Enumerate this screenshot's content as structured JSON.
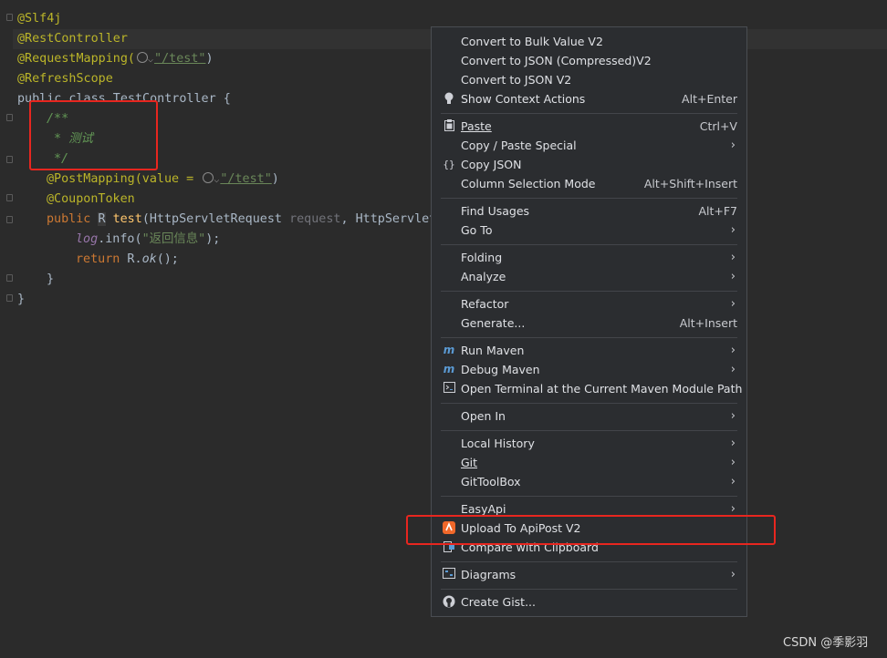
{
  "editor": {
    "lines": [
      "@Slf4j",
      "@RestController",
      "@RequestMapping(",
      "\"/test\"",
      ")",
      "@RefreshScope",
      "public class TestController {",
      "/**",
      "* 测试",
      "*/",
      "@PostMapping(value = ",
      "\"/test\"",
      ")",
      "@CouponToken",
      "public",
      "R",
      "test",
      "(HttpServletRequest ",
      "request",
      ", HttpServlet",
      "log",
      ".info(",
      "\"返回信息\"",
      ");",
      "return",
      " R.",
      "ok",
      "();",
      "}",
      "}"
    ]
  },
  "menu": {
    "items": [
      {
        "label": "Convert to Bulk Value V2",
        "shortcut": "",
        "submenu": false,
        "icon": ""
      },
      {
        "label": "Convert to JSON (Compressed)V2",
        "shortcut": "",
        "submenu": false,
        "icon": ""
      },
      {
        "label": "Convert to JSON V2",
        "shortcut": "",
        "submenu": false,
        "icon": ""
      },
      {
        "label": "Show Context Actions",
        "shortcut": "Alt+Enter",
        "submenu": false,
        "icon": "lightbulb-icon"
      },
      {
        "label": "Paste",
        "shortcut": "Ctrl+V",
        "submenu": false,
        "icon": "clipboard-icon"
      },
      {
        "label": "Copy / Paste Special",
        "shortcut": "",
        "submenu": true,
        "icon": ""
      },
      {
        "label": "Copy JSON",
        "shortcut": "",
        "submenu": false,
        "icon": "braces-icon"
      },
      {
        "label": "Column Selection Mode",
        "shortcut": "Alt+Shift+Insert",
        "submenu": false,
        "icon": ""
      },
      {
        "label": "Find Usages",
        "shortcut": "Alt+F7",
        "submenu": false,
        "icon": ""
      },
      {
        "label": "Go To",
        "shortcut": "",
        "submenu": true,
        "icon": ""
      },
      {
        "label": "Folding",
        "shortcut": "",
        "submenu": true,
        "icon": ""
      },
      {
        "label": "Analyze",
        "shortcut": "",
        "submenu": true,
        "icon": ""
      },
      {
        "label": "Refactor",
        "shortcut": "",
        "submenu": true,
        "icon": ""
      },
      {
        "label": "Generate...",
        "shortcut": "Alt+Insert",
        "submenu": false,
        "icon": ""
      },
      {
        "label": "Run Maven",
        "shortcut": "",
        "submenu": true,
        "icon": "maven-run-icon"
      },
      {
        "label": "Debug Maven",
        "shortcut": "",
        "submenu": true,
        "icon": "maven-debug-icon"
      },
      {
        "label": "Open Terminal at the Current Maven Module Path",
        "shortcut": "",
        "submenu": false,
        "icon": "terminal-icon"
      },
      {
        "label": "Open In",
        "shortcut": "",
        "submenu": true,
        "icon": ""
      },
      {
        "label": "Local History",
        "shortcut": "",
        "submenu": true,
        "icon": ""
      },
      {
        "label": "Git",
        "shortcut": "",
        "submenu": true,
        "icon": ""
      },
      {
        "label": "GitToolBox",
        "shortcut": "",
        "submenu": true,
        "icon": ""
      },
      {
        "label": "EasyApi",
        "shortcut": "",
        "submenu": true,
        "icon": ""
      },
      {
        "label": "Upload To ApiPost V2",
        "shortcut": "",
        "submenu": false,
        "icon": "apipost-icon"
      },
      {
        "label": "Compare with Clipboard",
        "shortcut": "",
        "submenu": false,
        "icon": "compare-icon"
      },
      {
        "label": "Diagrams",
        "shortcut": "",
        "submenu": true,
        "icon": "diagram-icon"
      },
      {
        "label": "Create Gist...",
        "shortcut": "",
        "submenu": false,
        "icon": "github-icon"
      }
    ]
  },
  "watermark": "CSDN @季影羽",
  "colors": {
    "highlight_box": "#e8261f",
    "menu_bg": "#2b2d30",
    "editor_bg": "#2b2b2b"
  }
}
